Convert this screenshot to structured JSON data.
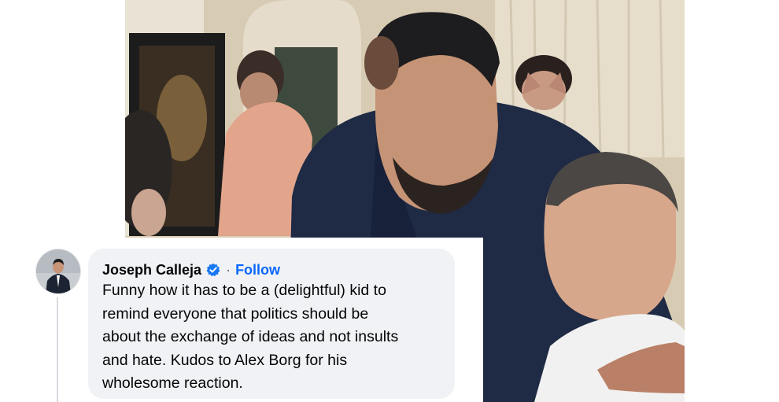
{
  "post_photo": {
    "description_icon": "photo"
  },
  "comment": {
    "author": "Joseph Calleja",
    "verified_icon": "verified-badge-icon",
    "separator": "·",
    "follow_label": "Follow",
    "lines": [
      "Funny how it has to be a (delightful) kid to",
      "remind everyone that politics should be",
      "about the exchange of ideas and not insults",
      "and hate. Kudos to Alex Borg for his",
      "wholesome reaction."
    ]
  },
  "colors": {
    "bubble_bg": "#f0f2f5",
    "follow_blue": "#0866ff",
    "verified_blue": "#1877f2",
    "text": "#050505"
  }
}
